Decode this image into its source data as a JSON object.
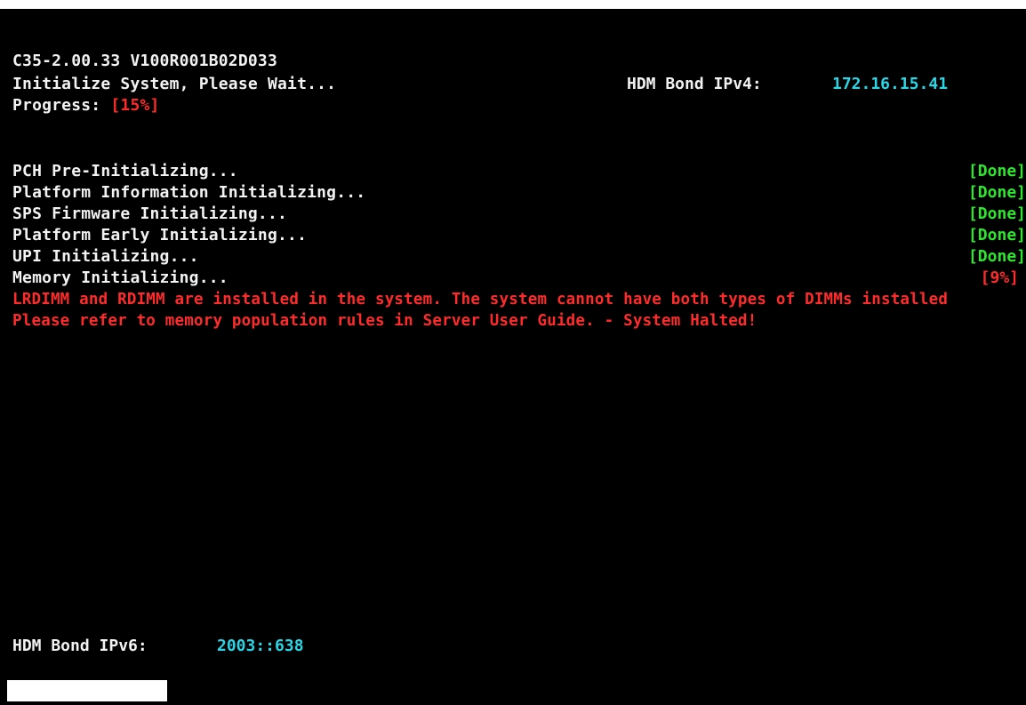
{
  "header": {
    "firmware_version": "C35-2.00.33 V100R001B02D033",
    "init_message": "Initialize System, Please Wait...",
    "progress_label": "Progress: ",
    "progress_value": "[15%]",
    "progress_percent": 15
  },
  "network": {
    "ipv4_label": "HDM Bond IPv4:",
    "ipv4_value": "172.16.15.41",
    "ipv6_label": "HDM Bond IPv6:",
    "ipv6_value": "2003::638"
  },
  "steps": [
    {
      "label": "PCH Pre-Initializing...",
      "status": "[Done]"
    },
    {
      "label": "Platform Information Initializing...",
      "status": "[Done]"
    },
    {
      "label": "SPS Firmware Initializing...",
      "status": "[Done]"
    },
    {
      "label": "Platform Early Initializing...",
      "status": "[Done]"
    },
    {
      "label": "UPI Initializing...",
      "status": "[Done]"
    },
    {
      "label": "Memory Initializing...",
      "status": "[9%]"
    }
  ],
  "errors": [
    "LRDIMM and RDIMM are installed in the system. The system cannot have both types of DIMMs installed",
    "Please refer to memory population rules in Server User Guide. - System Halted!"
  ],
  "colors": {
    "background": "#000000",
    "text": "#f2f2f2",
    "error": "#ff2b2b",
    "done": "#2ee62e",
    "ip": "#2ad6e6"
  }
}
